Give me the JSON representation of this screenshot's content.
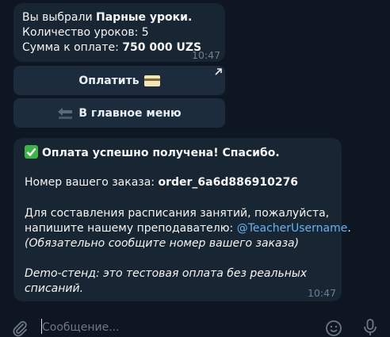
{
  "message_order": {
    "line1_prefix": "Вы выбрали ",
    "line1_bold": "Парные уроки.",
    "line2": "Количество уроков: 5",
    "line3_prefix": "Сумма к оплате: ",
    "line3_bold": "750 000 UZS",
    "time": "10:47"
  },
  "keyboard": {
    "pay_label": "Оплатить",
    "pay_icon": "credit-card-emoji",
    "main_menu_label": "В главное меню",
    "main_menu_icon": "back-arrow-emoji"
  },
  "message_success": {
    "title": "Оплата успешно получена! Спасибо.",
    "order_prefix": "Номер вашего заказа: ",
    "order_id": "order_6a6d886910276",
    "schedule_line1": "Для составления расписания занятий, пожалуйста,",
    "schedule_line2_prefix": "напишите нашему преподавателю: ",
    "teacher_handle": "@TeacherUsername",
    "schedule_line2_suffix": ".",
    "note": "(Обязательно сообщите номер вашего заказа)",
    "demo_line1": "Demo-стенд: это тестовая оплата без реальных",
    "demo_line2": "списаний.",
    "time": "10:47"
  },
  "composer": {
    "placeholder": "Сообщение..."
  },
  "colors": {
    "background": "#0e1621",
    "bubble": "#182533",
    "button": "#1c2c3c",
    "link": "#6ab2f2",
    "check": "#3fb24c"
  }
}
